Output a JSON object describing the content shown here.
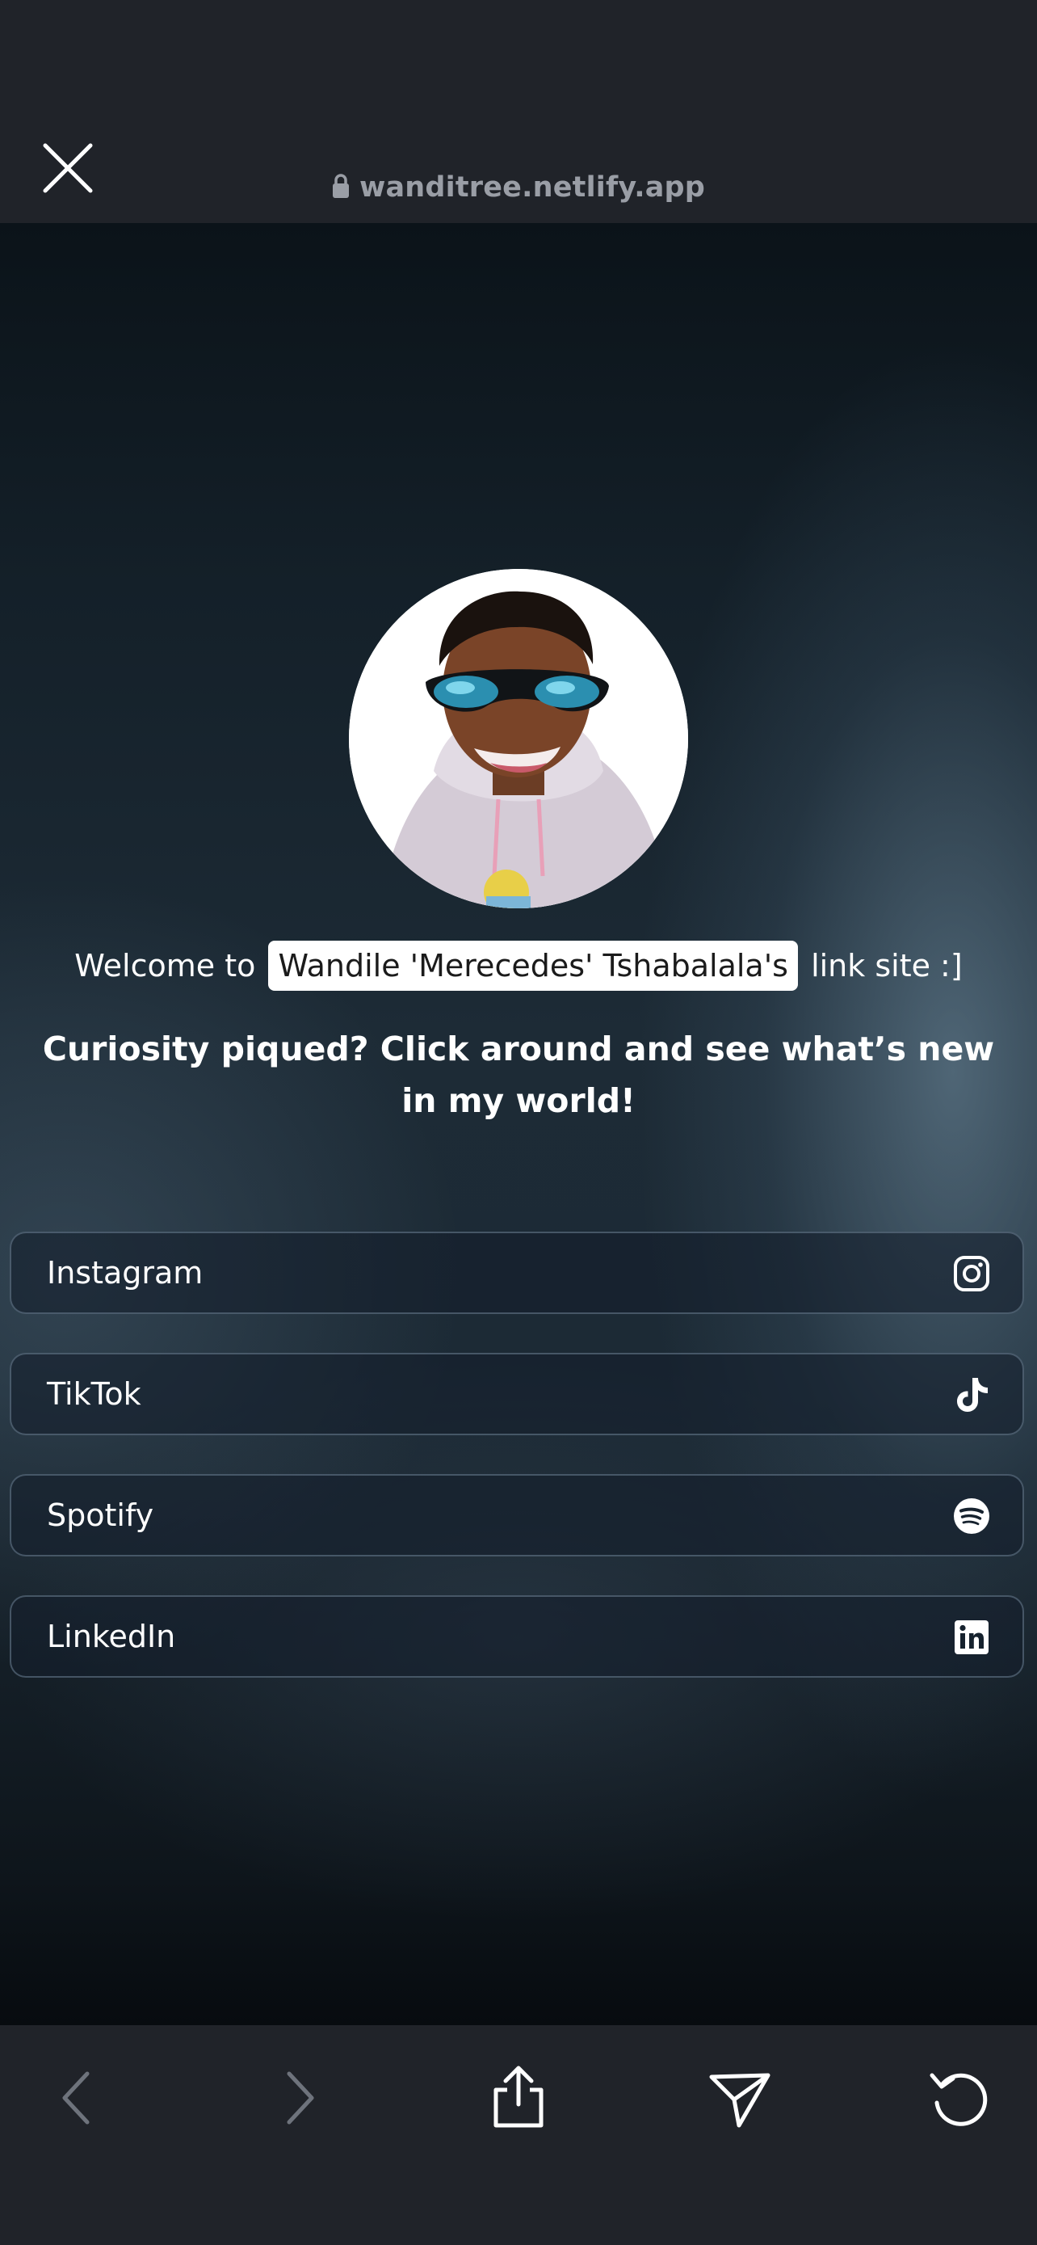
{
  "browser": {
    "url": "wanditree.netlify.app",
    "icons": {
      "close": "close-icon",
      "lock": "lock-icon",
      "back": "chevron-left-icon",
      "forward": "chevron-right-icon",
      "share": "share-icon",
      "send": "send-icon",
      "reload": "reload-icon"
    }
  },
  "profile": {
    "welcome_prefix": "Welcome to",
    "name_highlight": "Wandile 'Merecedes' Tshabalala's",
    "welcome_suffix": "link site :]",
    "tagline": "Curiosity piqued? Click around and see what’s new in my world!"
  },
  "links": [
    {
      "label": "Instagram",
      "icon": "instagram-icon"
    },
    {
      "label": "TikTok",
      "icon": "tiktok-icon"
    },
    {
      "label": "Spotify",
      "icon": "spotify-icon"
    },
    {
      "label": "LinkedIn",
      "icon": "linkedin-icon"
    }
  ],
  "colors": {
    "chrome": "#202329",
    "url_text": "#9a9ea6",
    "text": "#ffffff",
    "highlight_bg": "#ffffff"
  }
}
